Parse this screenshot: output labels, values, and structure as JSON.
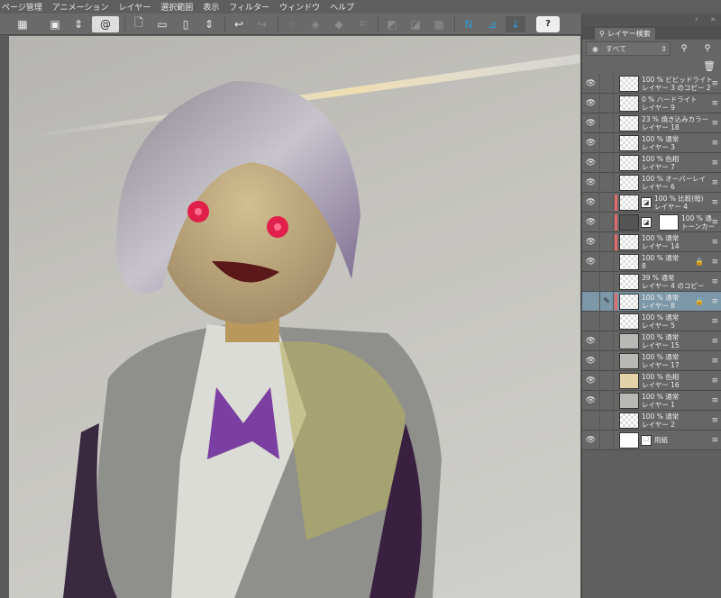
{
  "menu": [
    "ページ管理",
    "アニメーション",
    "レイヤー",
    "選択範囲",
    "表示",
    "フィルター",
    "ウィンドウ",
    "ヘルプ"
  ],
  "toolbar": {
    "help_label": "?"
  },
  "panel": {
    "tab_label": "レイヤー検索",
    "filter_value": "すべて"
  },
  "layers": [
    {
      "line1": "100 % ビビッドライト",
      "line2": "レイヤー 3 のコピー 2",
      "visible": true,
      "thumb": "trans"
    },
    {
      "line1": "0 % ハードライト",
      "line2": "レイヤー 9",
      "visible": true,
      "thumb": "trans"
    },
    {
      "line1": "23 % 焼き込みカラー",
      "line2": "レイヤー 18",
      "visible": true,
      "thumb": "trans"
    },
    {
      "line1": "100 % 通常",
      "line2": "レイヤー 3",
      "visible": true,
      "thumb": "trans"
    },
    {
      "line1": "100 % 色相",
      "line2": "レイヤー 7",
      "visible": true,
      "thumb": "trans"
    },
    {
      "line1": "100 % オーバーレイ",
      "line2": "レイヤー 6",
      "visible": true,
      "thumb": "trans"
    },
    {
      "line1": "100 % 比較(暗)",
      "line2": "レイヤー 4",
      "visible": true,
      "thumb": "trans",
      "clip": true,
      "mask": true
    },
    {
      "line1": "100 % 通",
      "line2": "トーンカー",
      "visible": true,
      "thumb": "dark",
      "clip": true,
      "mask": true,
      "white_mask": true
    },
    {
      "line1": "100 % 通常",
      "line2": "レイヤー 14",
      "visible": true,
      "thumb": "trans",
      "clip": true
    },
    {
      "line1": "100 % 通常",
      "line2": "8",
      "visible": true,
      "thumb": "trans",
      "lock": true
    },
    {
      "line1": "39 % 通常",
      "line2": "レイヤー 4 のコピー",
      "visible": false,
      "thumb": "trans"
    },
    {
      "line1": "100 % 通常",
      "line2": "レイヤー 8",
      "visible": false,
      "thumb": "trans",
      "selected": true,
      "clip": true,
      "lock": true
    },
    {
      "line1": "100 % 通常",
      "line2": "レイヤー 5",
      "visible": false,
      "thumb": "trans"
    },
    {
      "line1": "100 % 通常",
      "line2": "レイヤー 15",
      "visible": true,
      "thumb": "gray"
    },
    {
      "line1": "100 % 通常",
      "line2": "レイヤー 17",
      "visible": true,
      "thumb": "gray"
    },
    {
      "line1": "100 % 色相",
      "line2": "レイヤー 16",
      "visible": true,
      "thumb": "beige"
    },
    {
      "line1": "100 % 通常",
      "line2": "レイヤー 1",
      "visible": true,
      "thumb": "gray"
    },
    {
      "line1": "100 % 通常",
      "line2": "レイヤー 2",
      "visible": false,
      "thumb": "trans"
    },
    {
      "line1": "",
      "line2": "用紙",
      "visible": true,
      "thumb": "white",
      "paper": true
    }
  ]
}
